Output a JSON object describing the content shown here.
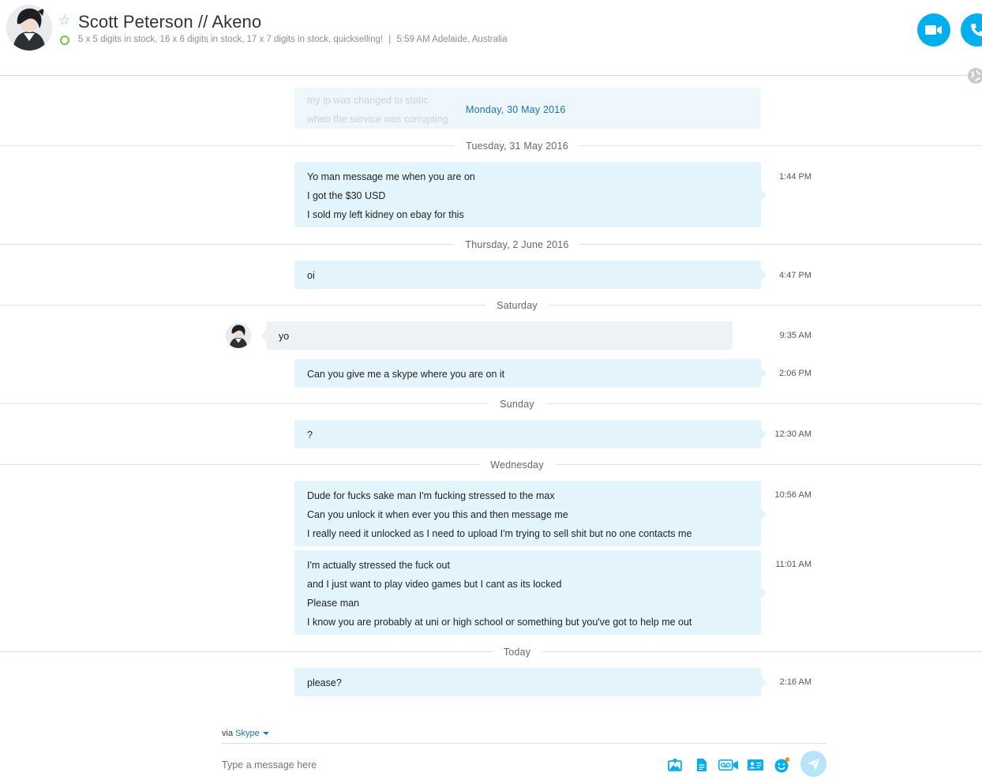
{
  "header": {
    "contact_name": "Scott Peterson // Akeno",
    "mood": "5 x 5 digits in stock, 16 x 6 digits in stock, 17 x 7 digits in stock, quickselling!",
    "separator": "|",
    "local_time": "5:59 AM Adelaide, Australia",
    "presence": "online",
    "icons": {
      "favorite": "star-outline-icon",
      "video": "video-camera-icon",
      "call": "phone-icon",
      "globe": "globe-icon"
    },
    "colors": {
      "accent": "#00aff0",
      "presence": "#7ac143"
    }
  },
  "conversation": {
    "faded_lines": [
      "my ip was changed to static",
      "when the service was corrupting"
    ],
    "sticky_date": "Monday, 30 May 2016",
    "days": [
      {
        "label": "Tuesday, 31 May 2016",
        "messages": [
          {
            "direction": "out",
            "lines": [
              "Yo man message me when you are on",
              "I got the $30 USD",
              "I sold my left kidney on ebay for this"
            ],
            "time": "1:44 PM"
          }
        ]
      },
      {
        "label": "Thursday, 2 June 2016",
        "messages": [
          {
            "direction": "out",
            "lines": [
              "oi"
            ],
            "time": "4:47 PM"
          }
        ]
      },
      {
        "label": "Saturday",
        "messages": [
          {
            "direction": "in",
            "lines": [
              "yo"
            ],
            "time": "9:35 AM"
          },
          {
            "direction": "out",
            "lines": [
              "Can you give me a skype where you are on it"
            ],
            "time": "2:06 PM"
          }
        ]
      },
      {
        "label": "Sunday",
        "messages": [
          {
            "direction": "out",
            "lines": [
              "?"
            ],
            "time": "12:30 AM"
          }
        ]
      },
      {
        "label": "Wednesday",
        "messages": [
          {
            "direction": "out",
            "lines": [
              "Dude for fucks sake man I'm fucking stressed to the max",
              "Can you unlock it when ever you this and then message me",
              "I really need it unlocked as I need to upload I'm trying to sell shit but no one contacts me"
            ],
            "time": "10:56 AM"
          },
          {
            "direction": "out",
            "lines": [
              "I'm actually stressed the fuck out",
              "and I just want to play video games but I cant as its locked",
              "Please man",
              "I know you are probably at uni or high school or something but you've got to help me out"
            ],
            "time": "11:01 AM"
          }
        ]
      },
      {
        "label": "Today",
        "messages": [
          {
            "direction": "out",
            "lines": [
              "please?"
            ],
            "time": "2:16 AM"
          }
        ]
      }
    ],
    "colors": {
      "outgoing_bubble": "#e3f4fc",
      "incoming_bubble": "#eef1f5"
    }
  },
  "composer": {
    "via_prefix": "via",
    "via_service": "Skype",
    "placeholder": "Type a message here",
    "tools": [
      "send-photo-icon",
      "send-file-icon",
      "video-message-icon",
      "send-contacts-icon",
      "emoticon-icon"
    ],
    "send": "send-icon"
  }
}
